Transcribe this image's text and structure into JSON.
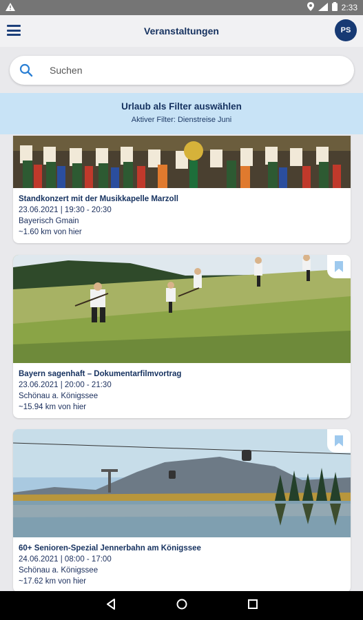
{
  "status": {
    "time": "2:33"
  },
  "appbar": {
    "title": "Veranstaltungen",
    "avatar_initials": "PS"
  },
  "search": {
    "placeholder": "Suchen"
  },
  "filter": {
    "title": "Urlaub als Filter auswählen",
    "active": "Aktiver Filter: Dienstreise Juni"
  },
  "events": [
    {
      "title": "Standkonzert mit der Musikkapelle Marzoll",
      "datetime": "23.06.2021 | 19:30 - 20:30",
      "location": "Bayerisch Gmain",
      "distance": "~1.60 km von hier"
    },
    {
      "title": "Bayern sagenhaft – Dokumentarfilmvortrag",
      "datetime": "23.06.2021 | 20:00 - 21:30",
      "location": "Schönau a. Königssee",
      "distance": "~15.94 km von hier"
    },
    {
      "title": "60+ Senioren-Spezial Jennerbahn am Königssee",
      "datetime": "24.06.2021 | 08:00 - 17:00",
      "location": "Schönau a. Königssee",
      "distance": "~17.62 km von hier"
    }
  ],
  "colors": {
    "primary": "#15315f",
    "accent": "#2a7fd4",
    "banner": "#c8e3f6"
  }
}
